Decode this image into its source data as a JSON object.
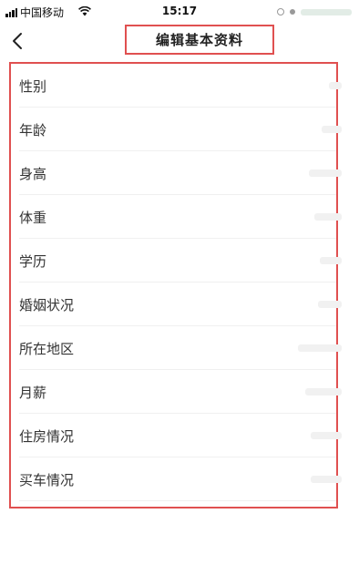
{
  "status_bar": {
    "carrier": "中国移动",
    "time": "15:17"
  },
  "nav": {
    "back_icon": "chevron-left-icon",
    "title": "编辑基本资料"
  },
  "form": {
    "rows": [
      {
        "label": "性别"
      },
      {
        "label": "年龄"
      },
      {
        "label": "身高"
      },
      {
        "label": "体重"
      },
      {
        "label": "学历"
      },
      {
        "label": "婚姻状况"
      },
      {
        "label": "所在地区"
      },
      {
        "label": "月薪"
      },
      {
        "label": "住房情况"
      },
      {
        "label": "买车情况"
      }
    ]
  },
  "colors": {
    "highlight_border": "#e05050",
    "divider": "#f0f0f0",
    "text": "#333333"
  }
}
